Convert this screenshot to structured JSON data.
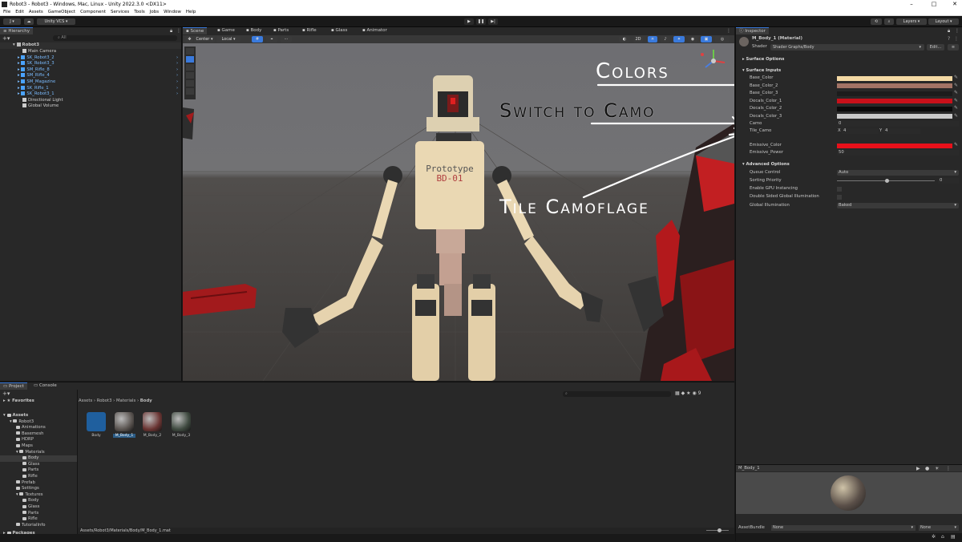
{
  "window": {
    "title": "Robot3 - Robot3 - Windows, Mac, Linux - Unity 2022.3.0 <DX11>"
  },
  "menu": [
    "File",
    "Edit",
    "Assets",
    "GameObject",
    "Component",
    "Services",
    "Tools",
    "Jobs",
    "Window",
    "Help"
  ],
  "toolbar": {
    "account": "J",
    "vcs": "Unity VCS",
    "layers": "Layers",
    "layout": "Layout"
  },
  "hierarchy": {
    "tab": "Hierarchy",
    "search_placeholder": "All",
    "root": "Robot3",
    "items": [
      "Main Camera",
      "SK_Robot3_2",
      "SK_Robot3_3",
      "SM_Rifle_8",
      "SM_Rifle_4",
      "SM_Magazine",
      "SK_Rifle_1",
      "SK_Robot3_1",
      "Directional Light",
      "Global Volume"
    ]
  },
  "scene": {
    "tabs": [
      "Scene",
      "Game",
      "Body",
      "Parts",
      "Rifle",
      "Glass",
      "Animator"
    ],
    "pivot": "Center",
    "space": "Local",
    "chest_text_1": "Prototype",
    "chest_text_2": "BD-01"
  },
  "annotations": {
    "colors": "Colors",
    "camo": "Switch to Camo",
    "tile": "Tile Camoflage"
  },
  "inspector": {
    "tab": "Inspector",
    "material_name": "M_Body_1 (Material)",
    "shader_label": "Shader",
    "shader_value": "Shader Graphs/Body",
    "edit_button": "Edit...",
    "surface_options": "Surface Options",
    "surface_inputs": "Surface Inputs",
    "properties": [
      {
        "label": "Base_Color",
        "color": "#f4d9a4"
      },
      {
        "label": "Base_Color_2",
        "color": "#a37365"
      },
      {
        "label": "Base_Color_3",
        "color": "#1c1c1c"
      },
      {
        "label": "Decals_Color_1",
        "color": "#c8101a"
      },
      {
        "label": "Decals_Color_2",
        "color": "#0b0b0b"
      },
      {
        "label": "Decals_Color_3",
        "color": "#c9c9c9"
      }
    ],
    "camo_label": "Camo",
    "camo_value": "0",
    "tile_label": "Tile_Camo",
    "tile_x_label": "X",
    "tile_x": "4",
    "tile_y_label": "Y",
    "tile_y": "4",
    "emissive_label": "Emissive_Color",
    "emissive_color": "#e8101a",
    "emissive_power_label": "Emissive_Power",
    "emissive_power": "50",
    "advanced": "Advanced Options",
    "queue_label": "Queue Control",
    "queue_value": "Auto",
    "sorting_label": "Sorting Priority",
    "sorting_value": "0",
    "gpu_label": "Enable GPU Instancing",
    "double_label": "Double Sided Global Illumination",
    "gi_label": "Global Illumination",
    "gi_value": "Baked",
    "preview_name": "M_Body_1",
    "assetbundle_label": "AssetBundle",
    "assetbundle_value": "None",
    "variant_value": "None"
  },
  "project": {
    "tabs": [
      "Project",
      "Console"
    ],
    "favorites": "Favorites",
    "tree": [
      {
        "label": "Assets",
        "depth": 0,
        "bold": true
      },
      {
        "label": "Robot3",
        "depth": 1
      },
      {
        "label": "Animations",
        "depth": 2
      },
      {
        "label": "Basemesh",
        "depth": 2
      },
      {
        "label": "HDRP",
        "depth": 2
      },
      {
        "label": "Maps",
        "depth": 2
      },
      {
        "label": "Materials",
        "depth": 2
      },
      {
        "label": "Body",
        "depth": 3,
        "selected": true
      },
      {
        "label": "Glass",
        "depth": 3
      },
      {
        "label": "Parts",
        "depth": 3
      },
      {
        "label": "Rifle",
        "depth": 3
      },
      {
        "label": "Prefab",
        "depth": 2
      },
      {
        "label": "Settings",
        "depth": 2
      },
      {
        "label": "Textures",
        "depth": 2
      },
      {
        "label": "Body",
        "depth": 3
      },
      {
        "label": "Glass",
        "depth": 3
      },
      {
        "label": "Parts",
        "depth": 3
      },
      {
        "label": "Rifle",
        "depth": 3
      },
      {
        "label": "TutorialInfo",
        "depth": 2
      },
      {
        "label": "Packages",
        "depth": 0,
        "bold": true
      }
    ],
    "breadcrumb": [
      "Assets",
      "Robot3",
      "Materials",
      "Body"
    ],
    "assets": [
      {
        "label": "Body",
        "color": "#1f5f9e"
      },
      {
        "label": "M_Body_1",
        "color": "#5a5450"
      },
      {
        "label": "M_Body_2",
        "color": "#6a3432"
      },
      {
        "label": "M_Body_3",
        "color": "#3f4a40"
      }
    ],
    "status_path": "Assets/Robot3/Materials/Body/M_Body_1.mat",
    "search_count": "9"
  }
}
